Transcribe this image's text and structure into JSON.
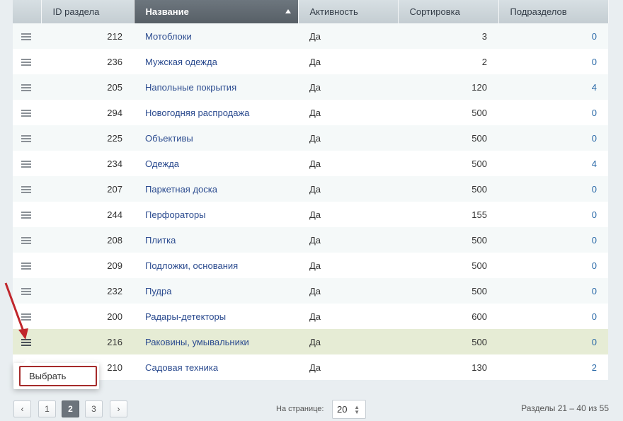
{
  "columns": {
    "id": "ID раздела",
    "name": "Название",
    "active": "Активность",
    "sort": "Сортировка",
    "subsections": "Подразделов"
  },
  "rows": [
    {
      "id": "212",
      "name": "Мотоблоки",
      "active": "Да",
      "sort": "3",
      "count": "0"
    },
    {
      "id": "236",
      "name": "Мужская одежда",
      "active": "Да",
      "sort": "2",
      "count": "0"
    },
    {
      "id": "205",
      "name": "Напольные покрытия",
      "active": "Да",
      "sort": "120",
      "count": "4"
    },
    {
      "id": "294",
      "name": "Новогодняя распродажа",
      "active": "Да",
      "sort": "500",
      "count": "0"
    },
    {
      "id": "225",
      "name": "Объективы",
      "active": "Да",
      "sort": "500",
      "count": "0"
    },
    {
      "id": "234",
      "name": "Одежда",
      "active": "Да",
      "sort": "500",
      "count": "4"
    },
    {
      "id": "207",
      "name": "Паркетная доска",
      "active": "Да",
      "sort": "500",
      "count": "0"
    },
    {
      "id": "244",
      "name": "Перфораторы",
      "active": "Да",
      "sort": "155",
      "count": "0"
    },
    {
      "id": "208",
      "name": "Плитка",
      "active": "Да",
      "sort": "500",
      "count": "0"
    },
    {
      "id": "209",
      "name": "Подложки, основания",
      "active": "Да",
      "sort": "500",
      "count": "0"
    },
    {
      "id": "232",
      "name": "Пудра",
      "active": "Да",
      "sort": "500",
      "count": "0"
    },
    {
      "id": "200",
      "name": "Радары-детекторы",
      "active": "Да",
      "sort": "600",
      "count": "0"
    },
    {
      "id": "216",
      "name": "Раковины, умывальники",
      "active": "Да",
      "sort": "500",
      "count": "0"
    },
    {
      "id": "210",
      "name": "Садовая техника",
      "active": "Да",
      "sort": "130",
      "count": "2"
    }
  ],
  "highlighted_row": 12,
  "context_menu": {
    "select_label": "Выбрать"
  },
  "pagination": {
    "prev_icon": "‹",
    "next_icon": "›",
    "pages": [
      "1",
      "2",
      "3"
    ],
    "current": "2",
    "per_page_label": "На странице:",
    "per_page_value": "20",
    "summary": "Разделы 21 – 40 из 55"
  },
  "colors": {
    "accent_arrow": "#c0262c",
    "link": "#2b4b8f",
    "header_active": "#5e666d"
  }
}
